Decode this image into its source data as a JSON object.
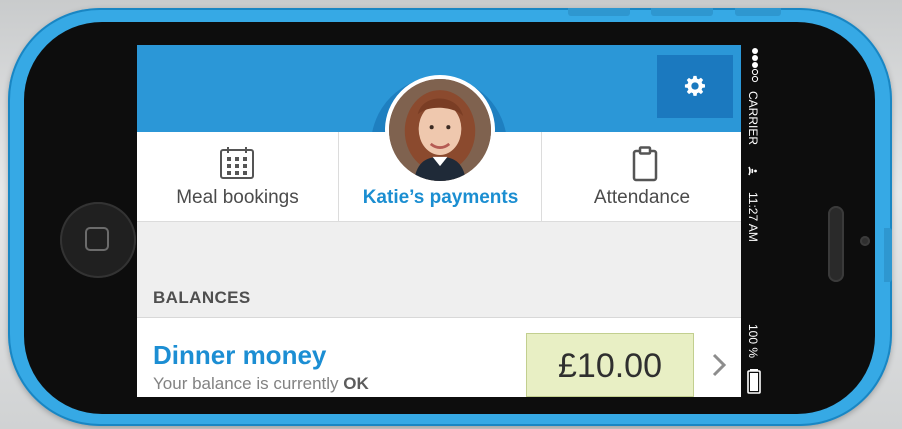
{
  "status_bar": {
    "carrier": "CARRIER",
    "time": "11:27 AM",
    "battery_percent": "100 %"
  },
  "nav": {
    "tabs": [
      {
        "label": "Meal bookings",
        "icon": "calendar-icon"
      },
      {
        "label": "Katie’s payments",
        "icon": "avatar"
      },
      {
        "label": "Attendance",
        "icon": "clipboard-icon"
      }
    ],
    "active_tab": "Katie’s payments"
  },
  "settings": {
    "icon": "gear-icon"
  },
  "balances": {
    "section_label": "BALANCES",
    "items": [
      {
        "title": "Dinner money",
        "status_prefix": "Your balance is currently ",
        "status_value": "OK",
        "amount": "£10.00"
      }
    ]
  },
  "colors": {
    "phone_shell": "#36a9e5",
    "header_blue": "#2b97d7",
    "settings_blue": "#1b79bf",
    "accent_blue": "#1c8ed3",
    "amount_bg": "#e8efc4"
  }
}
